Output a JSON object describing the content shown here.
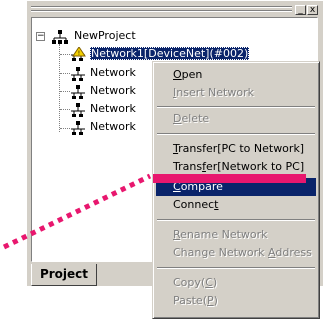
{
  "window": {
    "title_buttons": [
      "_",
      "x"
    ]
  },
  "tree": {
    "root": {
      "label": "NewProject",
      "expander": "⊟"
    },
    "networks": [
      {
        "label": "Network1[DeviceNet](#002)",
        "selected": true
      },
      {
        "label": "Network",
        "selected": false
      },
      {
        "label": "Network",
        "selected": false
      },
      {
        "label": "Network",
        "selected": false
      },
      {
        "label": "Network",
        "selected": false
      }
    ]
  },
  "tabs": [
    {
      "label": "Project"
    }
  ],
  "context_menu": {
    "items": [
      {
        "id": "open",
        "pre": "",
        "mn": "O",
        "post": "pen",
        "disabled": false
      },
      {
        "id": "insert-network",
        "pre": "",
        "mn": "I",
        "post": "nsert Network",
        "disabled": true
      },
      {
        "id": "delete",
        "pre": "",
        "mn": "D",
        "post": "elete",
        "disabled": true
      },
      {
        "id": "transfer-pc-to-network",
        "pre": "",
        "mn": "T",
        "post": "ransfer[PC to Network]",
        "disabled": false
      },
      {
        "id": "transfer-network-to-pc",
        "pre": "Trans",
        "mn": "f",
        "post": "er[Network to PC]",
        "disabled": false
      },
      {
        "id": "compare",
        "pre": "",
        "mn": "C",
        "post": "ompare",
        "disabled": false,
        "active": true
      },
      {
        "id": "connect",
        "pre": "Connec",
        "mn": "t",
        "post": "",
        "disabled": false
      },
      {
        "id": "rename-network",
        "pre": "",
        "mn": "R",
        "post": "ename Network",
        "disabled": true
      },
      {
        "id": "change-network-address",
        "pre": "Change Network ",
        "mn": "A",
        "post": "ddress",
        "disabled": true
      },
      {
        "id": "copy",
        "pre": "Copy(",
        "mn": "C",
        "post": ")",
        "disabled": true
      },
      {
        "id": "paste",
        "pre": "Paste(",
        "mn": "P",
        "post": ")",
        "disabled": true
      }
    ]
  },
  "colors": {
    "selection": "#0a246a",
    "annotation": "#e8176e",
    "face": "#d4d0c8"
  }
}
